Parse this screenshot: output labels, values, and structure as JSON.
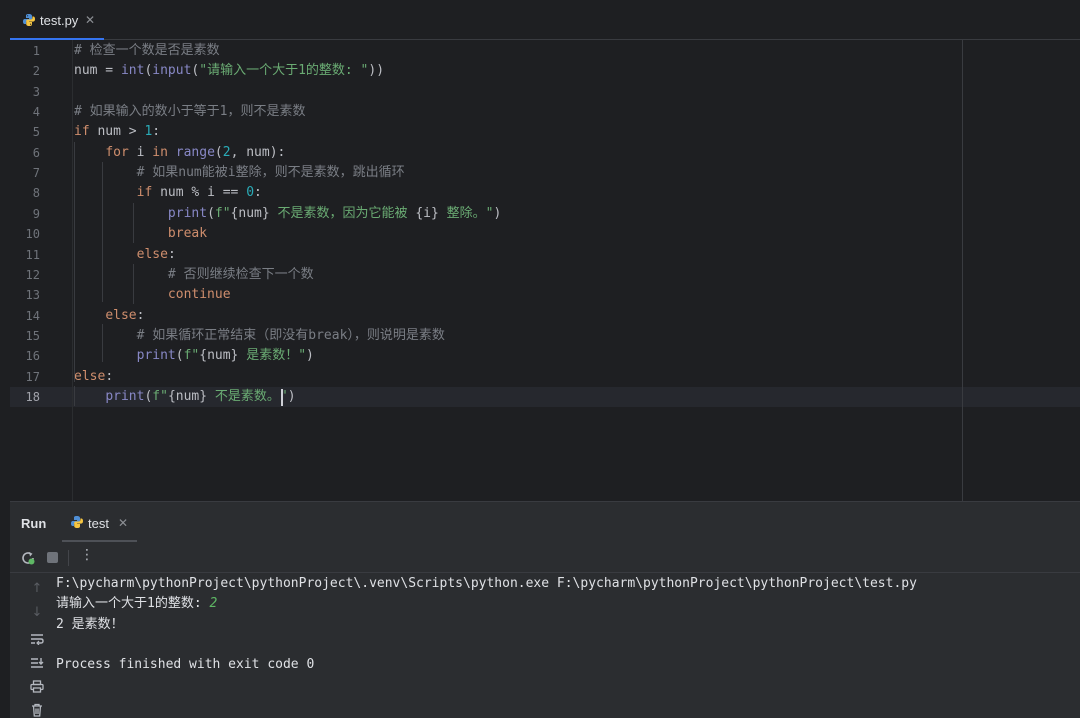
{
  "editor_tab": {
    "filename": "test.py",
    "icon": "python-file-icon",
    "accent": "#3574f0"
  },
  "editor": {
    "line_numbers": [
      "1",
      "2",
      "3",
      "4",
      "5",
      "6",
      "7",
      "8",
      "9",
      "10",
      "11",
      "12",
      "13",
      "14",
      "15",
      "16",
      "17",
      "18"
    ],
    "active_line": "18",
    "lines": [
      [
        {
          "t": "# 检查一个数是否是素数",
          "c": "cm"
        }
      ],
      [
        {
          "t": "num = ",
          "c": ""
        },
        {
          "t": "int",
          "c": "bi"
        },
        {
          "t": "(",
          "c": ""
        },
        {
          "t": "input",
          "c": "bi"
        },
        {
          "t": "(",
          "c": ""
        },
        {
          "t": "\"请输入一个大于1的整数: \"",
          "c": "str"
        },
        {
          "t": "))",
          "c": ""
        }
      ],
      [],
      [
        {
          "t": "# 如果输入的数小于等于1，则不是素数",
          "c": "cm"
        }
      ],
      [
        {
          "t": "if",
          "c": "kw"
        },
        {
          "t": " num > ",
          "c": ""
        },
        {
          "t": "1",
          "c": "num"
        },
        {
          "t": ":",
          "c": ""
        }
      ],
      [
        {
          "t": "    ",
          "c": ""
        },
        {
          "t": "for",
          "c": "kw"
        },
        {
          "t": " i ",
          "c": ""
        },
        {
          "t": "in",
          "c": "kw"
        },
        {
          "t": " ",
          "c": ""
        },
        {
          "t": "range",
          "c": "bi"
        },
        {
          "t": "(",
          "c": ""
        },
        {
          "t": "2",
          "c": "num"
        },
        {
          "t": ", num):",
          "c": ""
        }
      ],
      [
        {
          "t": "        ",
          "c": ""
        },
        {
          "t": "# 如果num能被i整除，则不是素数，跳出循环",
          "c": "cm"
        }
      ],
      [
        {
          "t": "        ",
          "c": ""
        },
        {
          "t": "if",
          "c": "kw"
        },
        {
          "t": " num % i == ",
          "c": ""
        },
        {
          "t": "0",
          "c": "num"
        },
        {
          "t": ":",
          "c": ""
        }
      ],
      [
        {
          "t": "            ",
          "c": ""
        },
        {
          "t": "print",
          "c": "bi"
        },
        {
          "t": "(",
          "c": ""
        },
        {
          "t": "f\"",
          "c": "str"
        },
        {
          "t": "{num}",
          "c": ""
        },
        {
          "t": " 不是素数，因为它能被 ",
          "c": "str"
        },
        {
          "t": "{i}",
          "c": ""
        },
        {
          "t": " 整除。\"",
          "c": "str"
        },
        {
          "t": ")",
          "c": ""
        }
      ],
      [
        {
          "t": "            ",
          "c": ""
        },
        {
          "t": "break",
          "c": "kw"
        }
      ],
      [
        {
          "t": "        ",
          "c": ""
        },
        {
          "t": "else",
          "c": "kw"
        },
        {
          "t": ":",
          "c": ""
        }
      ],
      [
        {
          "t": "            ",
          "c": ""
        },
        {
          "t": "# 否则继续检查下一个数",
          "c": "cm"
        }
      ],
      [
        {
          "t": "            ",
          "c": ""
        },
        {
          "t": "continue",
          "c": "kw"
        }
      ],
      [
        {
          "t": "    ",
          "c": ""
        },
        {
          "t": "else",
          "c": "kw"
        },
        {
          "t": ":",
          "c": ""
        }
      ],
      [
        {
          "t": "        ",
          "c": ""
        },
        {
          "t": "# 如果循环正常结束（即没有break），则说明是素数",
          "c": "cm"
        }
      ],
      [
        {
          "t": "        ",
          "c": ""
        },
        {
          "t": "print",
          "c": "bi"
        },
        {
          "t": "(",
          "c": ""
        },
        {
          "t": "f\"",
          "c": "str"
        },
        {
          "t": "{num}",
          "c": ""
        },
        {
          "t": " 是素数！\"",
          "c": "str"
        },
        {
          "t": ")",
          "c": ""
        }
      ],
      [
        {
          "t": "else",
          "c": "kw"
        },
        {
          "t": ":",
          "c": ""
        }
      ],
      [
        {
          "t": "    ",
          "c": ""
        },
        {
          "t": "print",
          "c": "bi"
        },
        {
          "t": "(",
          "c": ""
        },
        {
          "t": "f\"",
          "c": "str"
        },
        {
          "t": "{num}",
          "c": ""
        },
        {
          "t": " 不是素数。\"",
          "c": "str"
        },
        {
          "t": ")",
          "c": ""
        }
      ]
    ]
  },
  "run_panel": {
    "title": "Run",
    "tab_label": "test",
    "toolbar_icons": [
      "rerun-icon",
      "stop-icon",
      "more-options-icon"
    ],
    "side_icons": [
      "scroll-up-icon",
      "scroll-down-icon",
      "soft-wrap-icon",
      "scroll-to-end-icon",
      "print-icon",
      "clear-icon"
    ],
    "output": {
      "command": "F:\\pycharm\\pythonProject\\pythonProject\\.venv\\Scripts\\python.exe F:\\pycharm\\pythonProject\\pythonProject\\test.py",
      "prompt": "请输入一个大于1的整数: ",
      "user_input": "2",
      "result": "2 是素数！",
      "exit_message": "Process finished with exit code 0"
    }
  }
}
